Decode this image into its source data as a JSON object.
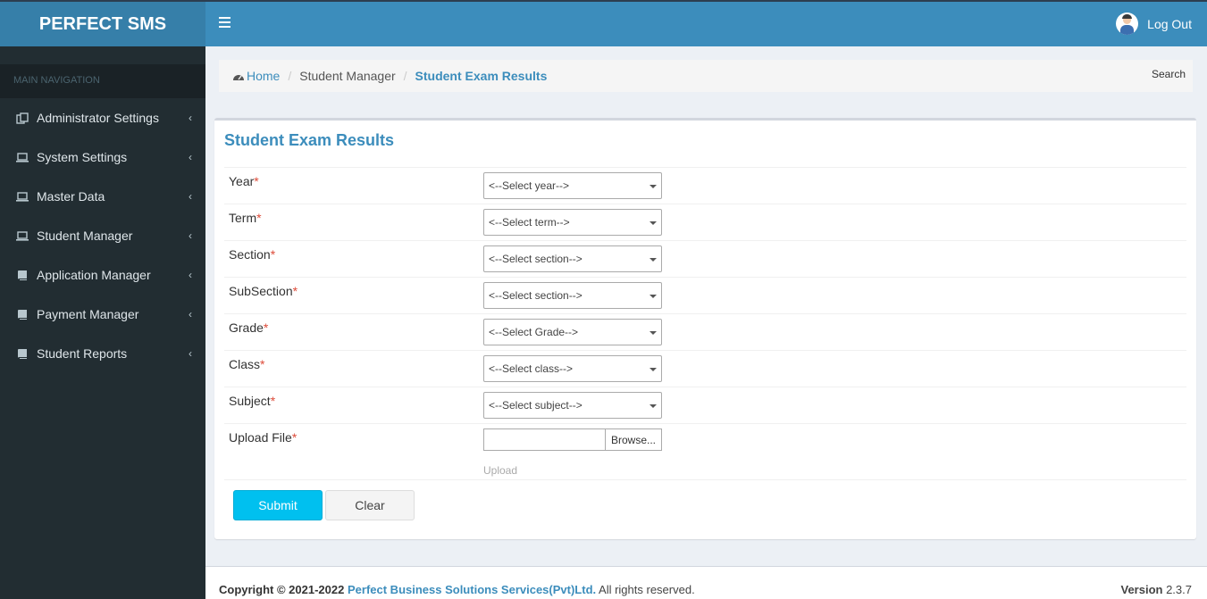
{
  "app": {
    "title": "PERFECT SMS"
  },
  "sidebar": {
    "header": "MAIN NAVIGATION",
    "items": [
      {
        "label": "Administrator Settings",
        "icon": "copy-icon"
      },
      {
        "label": "System Settings",
        "icon": "laptop-icon"
      },
      {
        "label": "Master Data",
        "icon": "laptop-icon"
      },
      {
        "label": "Student Manager",
        "icon": "laptop-icon"
      },
      {
        "label": "Application Manager",
        "icon": "book-icon"
      },
      {
        "label": "Payment Manager",
        "icon": "book-icon"
      },
      {
        "label": "Student Reports",
        "icon": "book-icon"
      }
    ]
  },
  "topbar": {
    "logout_label": "Log Out"
  },
  "breadcrumb": {
    "home": "Home",
    "parent": "Student Manager",
    "current": "Student Exam Results",
    "search": "Search"
  },
  "form": {
    "title": "Student Exam Results",
    "fields": [
      {
        "label": "Year",
        "value": "<--Select year-->"
      },
      {
        "label": "Term",
        "value": "<--Select term-->"
      },
      {
        "label": "Section",
        "value": "<--Select section-->"
      },
      {
        "label": "SubSection",
        "value": "<--Select section-->"
      },
      {
        "label": "Grade",
        "value": "<--Select Grade-->"
      },
      {
        "label": "Class",
        "value": "<--Select class-->"
      },
      {
        "label": "Subject",
        "value": "<--Select subject-->"
      }
    ],
    "upload": {
      "label": "Upload File",
      "browse": "Browse...",
      "note": "Upload"
    },
    "submit": "Submit",
    "clear": "Clear"
  },
  "footer": {
    "copyright": "Copyright © 2021-2022",
    "company": "Perfect Business Solutions Services(Pvt)Ltd.",
    "rights": "All rights reserved.",
    "version_label": "Version",
    "version": "2.3.7"
  },
  "colors": {
    "brand": "#3c8dbc",
    "sidebar": "#222d32",
    "submit": "#00c0ef",
    "required": "#dd4b39"
  }
}
